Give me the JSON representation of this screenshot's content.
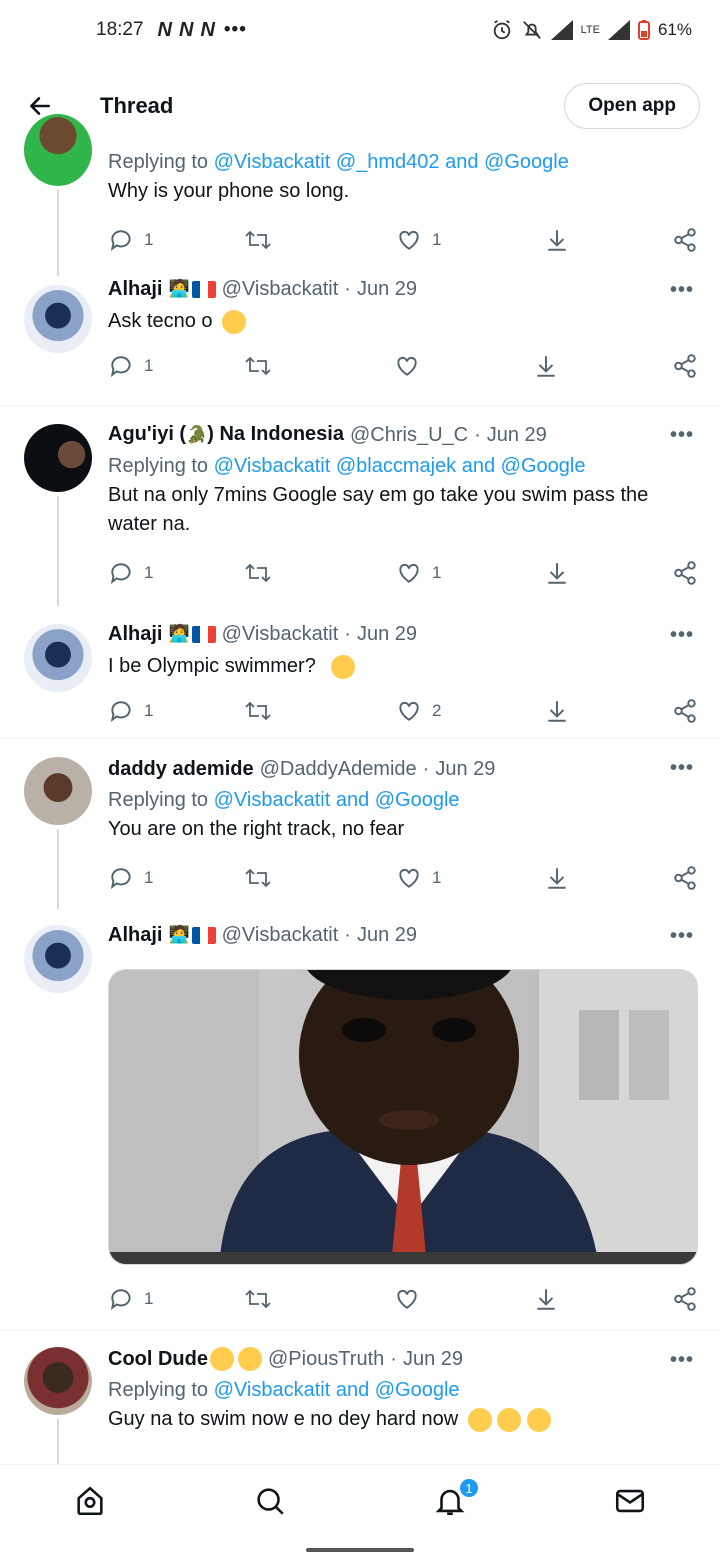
{
  "status_bar": {
    "time": "18:27",
    "network_icons": [
      "N",
      "N",
      "N"
    ],
    "more": "•••",
    "lte": "LTE",
    "battery": "61%"
  },
  "header": {
    "title": "Thread",
    "open_app": "Open app"
  },
  "tweets": [
    {
      "name": "",
      "handle": "",
      "date": "",
      "replying_prefix": "Replying to ",
      "replying_links": "@Visbackatit @_hmd402 and @Google",
      "text": "Why is your phone so long.",
      "reply_count": "1",
      "like_count": "1"
    },
    {
      "name": "Alhaji",
      "handle": "@Visbackatit",
      "sep": "·",
      "date": "Jun 29",
      "text": "Ask tecno o",
      "reply_count": "1",
      "like_count": ""
    },
    {
      "name_prefix": "Agu'iyi (",
      "name_suffix": ") Na Indonesia",
      "handle": "@Chris_U_C",
      "sep": "·",
      "date": "Jun 29",
      "replying_prefix": "Replying to ",
      "replying_links": "@Visbackatit @blaccmajek and @Google",
      "text": "But na only 7mins Google say em go take you swim pass the water na.",
      "reply_count": "1",
      "like_count": "1"
    },
    {
      "name": "Alhaji",
      "handle": "@Visbackatit",
      "sep": "·",
      "date": "Jun 29",
      "text": "I be Olympic swimmer?",
      "reply_count": "1",
      "like_count": "2"
    },
    {
      "name": "daddy ademide",
      "handle": "@DaddyAdemide",
      "sep": "·",
      "date": "Jun 29",
      "replying_prefix": "Replying to ",
      "replying_links": "@Visbackatit and @Google",
      "text": "You are on the right track, no fear",
      "reply_count": "1",
      "like_count": "1"
    },
    {
      "name": "Alhaji",
      "handle": "@Visbackatit",
      "sep": "·",
      "date": "Jun 29",
      "reply_count": "1",
      "like_count": ""
    },
    {
      "name": "Cool Dude",
      "handle": "@PiousTruth",
      "sep": "·",
      "date": "Jun 29",
      "replying_prefix": "Replying to ",
      "replying_links": "@Visbackatit and @Google",
      "text": "Guy na to swim now e no dey hard now"
    }
  ],
  "more_label": "•••",
  "bottom_nav": {
    "notifications_badge": "1"
  },
  "colors": {
    "link": "#1d9bf0",
    "secondary": "#536471",
    "primary": "#0f1419",
    "divider": "#eff3f4"
  },
  "icons": [
    "back-arrow-icon",
    "reply-icon",
    "retweet-icon",
    "heart-icon",
    "download-icon",
    "share-icon",
    "more-icon",
    "home-icon",
    "search-icon",
    "bell-icon",
    "mail-icon"
  ]
}
